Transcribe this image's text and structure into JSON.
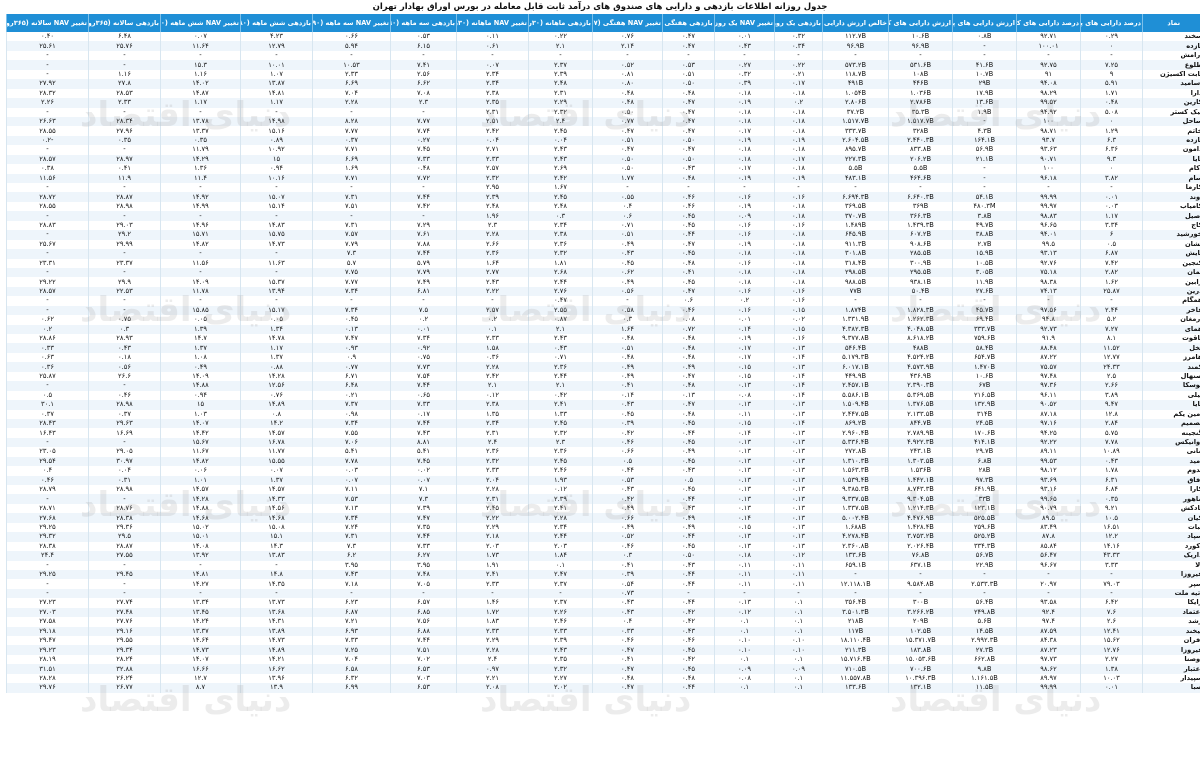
{
  "title": "جدول روزانه اطلاعات بازدهی و دارایی های صندوق های درآمد ثابت قابل معامله در بورس اوراق بهادار تهران",
  "watermark": "دنیای اقتصاد",
  "watermark_sub": "روزنامه صبح ایران",
  "columns": [
    "نماد",
    "درصد دارایی های پرریسک",
    "درصد دارایی های کم ریسک",
    "ارزش دارایی های پرریسک",
    "ارزش دارایی های کم ریسک",
    "خالص ارزش دارایی ها",
    "بازدهی یک روزه",
    "تغییر NAV یک روزه",
    "بازدهی هفتگی",
    "تغییر NAV هفتگی (۷روزه)",
    "بازدهی ماهانه (۳۰روزه)",
    "تغییر NAV ماهانه (۳۰روزه)",
    "بازدهی سه ماهه (۹۰روزه)",
    "تغییر NAV سه ماهه (۹۰روزه)",
    "بازدهی شش ماهه (۱۸۰روزه)",
    "تغییر NAV شش ماهه (۱۸۰روزه)",
    "بازدهی سالانه (۳۶۵روزه)",
    "تغییر NAV سالانه (۳۶۵روزه)"
  ],
  "rows": [
    [
      "سخند",
      "۰.۲۹",
      "۹۲.۷۱",
      "۰.۸B",
      "۱۰.۶B",
      "۱۱۲.۷B",
      "۰.۳۲",
      "۰.۰۱",
      "۰.۴۷",
      "۰.۷۶",
      "۰.۲۲",
      "۰.۱۱",
      "۰.۵۳",
      "۰.۶۶",
      "۴.۲۳",
      "۰.۰۷",
      "۶.۴۸",
      "۰.۴۰"
    ],
    [
      "بازده",
      "۰",
      "۱۰۰.۰۱",
      "-",
      "۹۶.۹B",
      "۹۶.۹B",
      "۰.۳۴",
      "۰.۴۳",
      "۰.۴۷",
      "۲.۱۴",
      "۲.۱",
      "۰.۶۱",
      "۶.۱۵",
      "۵.۹۴",
      "۱۲.۷۹",
      "۱۱.۶۴",
      "۲۵.۷۶",
      "۲۵.۶۱"
    ],
    [
      "آرامش",
      "-",
      "-",
      "-",
      "-",
      "-",
      "-",
      "-",
      "-",
      "-",
      "-",
      "-",
      "-",
      "-",
      "-",
      "-",
      "-",
      "-"
    ],
    [
      "طلوع",
      "۷.۲۵",
      "۹۲.۷۵",
      "۴۱.۶B",
      "۵۳۱.۶B",
      "۵۷۳.۲B",
      "۰.۲۲",
      "۰.۲۷",
      "۰.۵۳",
      "۰.۵۲",
      "۲.۳۷",
      "۰.۰۷",
      "۷.۴۱",
      "۱۰.۵۳",
      "۱۰.۰۱",
      "۱۵.۳",
      "-",
      "-"
    ],
    [
      "ثابت اکسیژن",
      "۹",
      "۹۱",
      "۱۰.۷B",
      "۱۰۸B",
      "۱۱۸.۷B",
      "۰.۲۱",
      "۰.۳۲",
      "۰.۵۱",
      "۰.۸۱",
      "۲.۳۹",
      "۲.۳۴",
      "۲.۵۶",
      "۲.۳۳",
      "۱.۰۷",
      "۱.۱۶",
      "۱.۱۶",
      "-"
    ],
    [
      "اسامید",
      "۵.۹۱",
      "۹۴.۰۸",
      "۲۹B",
      "۴۴۶B",
      "۴۹۱B",
      "۰.۱۷",
      "۰.۳۹",
      "۰.۵۰",
      "۰.۸۰",
      "۲.۴۸",
      "۲.۳۴",
      "۶.۶۲",
      "۶.۶۹",
      "۱۳.۸۷",
      "۱۴.۰۲",
      "۲۷.۸",
      "۲۷.۹۲"
    ],
    [
      "دارا",
      "۱.۷۱",
      "۹۸.۲۹",
      "۱۷.۹B",
      "۱.۰۳۶B",
      "۱.۰۵۴B",
      "۰.۱۸",
      "۰.۱۸",
      "۰.۴۸",
      "۰.۴۸",
      "۲.۳۱",
      "۲.۳۸",
      "۷.۰۸",
      "۷.۰۴",
      "۱۴.۸۱",
      "۱۴.۸۷",
      "۲۸.۵۳",
      "۲۸.۳۲"
    ],
    [
      "کارین",
      "۰.۴۸",
      "۹۹.۵۲",
      "۱۳.۶B",
      "۲.۷۸۶B",
      "۲.۸۰۶B",
      "۰.۲",
      "۰.۱۹",
      "۰.۴۷",
      "۰.۴۸",
      "۲.۲۹",
      "۲.۳۵",
      "۲.۳",
      "۲.۲۸",
      "۱.۱۷",
      "۱.۱۷",
      "۲.۳۳",
      "۲.۲۶"
    ],
    [
      "نیک کستر",
      "۵.۰۸",
      "۹۴.۹۲",
      "۱.۹B",
      "۳۵.۳B",
      "۳۷.۲B",
      "۰.۱۸",
      "۰.۱۸",
      "۰.۴۷",
      "۰.۵۰",
      "۲.۳۲",
      "۲.۳۱",
      "-",
      "-",
      "-",
      "-",
      "-",
      "-"
    ],
    [
      "ساحل",
      "۰",
      "۱۰۰",
      "-",
      "۱.۵۱۷.۷B",
      "۱.۵۱۷.۷B",
      "۰.۱۸",
      "۰.۱۸",
      "۰.۴۷",
      "۰.۷۷",
      "۲.۴",
      "۲.۵۱",
      "۷.۷۷",
      "۸.۲۸",
      "۱۴.۹۸",
      "۱۳.۷۸",
      "۲۸.۳۴",
      "۲۶.۶۳"
    ],
    [
      "خاتم",
      "۱.۲۹",
      "۹۸.۷۱",
      "۴.۳B",
      "۳۲۸B",
      "۳۳۳.۷B",
      "۰.۱۸",
      "۰.۱۷",
      "۰.۴۷",
      "۰.۴۷",
      "۲.۴۵",
      "۲.۴۲",
      "۷.۷۴",
      "۷.۷۷",
      "۱۵.۱۶",
      "۱۳.۳۷",
      "۲۷.۹۶",
      "۲۸.۵۵"
    ],
    [
      "بازده",
      "۶.۳",
      "۹۳.۷",
      "۱۶۴.۱B",
      "۲.۴۴۰.۳B",
      "۲.۶۰۴.۵B",
      "۰.۱۹",
      "۰.۱۹",
      "۰.۵۰",
      "۰.۵۱",
      "۰.۰۴",
      "۰.۰۴",
      "۰.۲۷",
      "۰.۳۷",
      "۰.۸۹",
      "۰.۳۵",
      "۰.۳۵",
      "-۰.۲"
    ],
    [
      "دامون",
      "۶.۳۶",
      "۹۳.۶۳",
      "۵۶.۹B",
      "۸۳۳.۸B",
      "۸۹۵.۷B",
      "۰.۱۸",
      "۰.۱۸",
      "۰.۴۷",
      "۰.۴۷",
      "۲.۴۳",
      "۲.۷۱",
      "۷.۴۵",
      "۷.۷۱",
      "۱۰.۹۲",
      "۱۱.۷۹",
      "-",
      "-"
    ],
    [
      "پایا",
      "۹.۳",
      "۹۰.۷۱",
      "۲۱.۱B",
      "۲۰۶.۲B",
      "۲۲۷.۳B",
      "۰.۱۷",
      "۰.۱۸",
      "۰.۵۰",
      "۰.۵۰",
      "۲.۴۳",
      "۲.۳۳",
      "۷.۳۳",
      "۶.۶۹",
      "۱۵",
      "۱۴.۲۹",
      "۲۸.۹۷",
      "۲۸.۵۷"
    ],
    [
      "آکام",
      "۰",
      "۱۰۰",
      "-",
      "۵.۵B",
      "۵.۵B",
      "۰.۱۸",
      "۰.۱۷",
      "۰.۴۳",
      "۰.۵۰",
      "۲.۶۹",
      "۲.۵۷",
      "۰.۴۸",
      "۱.۶۹",
      "۰.۹۴",
      "۱.۳۶",
      "۰.۴۱",
      "۰.۳۸"
    ],
    [
      "سام",
      "۳.۸۲",
      "۹۶.۱۸",
      "-",
      "۴۶۴.۶B",
      "۴۸۳.۱B",
      "۰.۱۹",
      "۰.۱۹",
      "۰.۴۸",
      "۱.۷۷",
      "۲.۴۲",
      "۲.۳۲",
      "۷.۷۲",
      "۷.۷۱",
      "۱۰.۱۶",
      "۱۱.۴",
      "۱۱.۹",
      "۱۱.۵۶"
    ],
    [
      "کارما",
      "-",
      "-",
      "-",
      "-",
      "-",
      "-",
      "-",
      "-",
      "-",
      "۱.۶۷",
      "۲.۹۵",
      "-",
      "-",
      "-",
      "-",
      "-",
      "-"
    ],
    [
      "آوند",
      "۰.۰۱",
      "۹۹.۹۹",
      "۵۴.۱B",
      "۶.۶۴۰.۳B",
      "۶.۶۹۴.۳B",
      "۰.۱۶",
      "۰.۱۶",
      "۰.۴۶",
      "۰.۵۵",
      "۲.۴۵",
      "۲.۳۹",
      "۷.۴۴",
      "۷.۳۱",
      "۱۵.۰۷",
      "۱۴.۹۲",
      "۲۸.۸۷",
      "۲۸.۷۲"
    ],
    [
      "کامیاب",
      "۰.۰۳",
      "۹۹.۹۷",
      "۴۸۰.۳M",
      "۳۶۹B",
      "۳۶۹.۵B",
      "۰.۱۸",
      "۰.۱۹",
      "۰.۴۶",
      "۰.۴",
      "۲.۴۸",
      "۲.۴۸",
      "۷.۴۲",
      "۷.۵۱",
      "۱۵.۱۴",
      "۱۴.۹۹",
      "۲۸.۹۸",
      "۲۸.۵۵"
    ],
    [
      "اصیل",
      "۱.۱۷",
      "۹۸.۸۳",
      "۳.۸B",
      "۳۶۶.۳B",
      "۳۷۰.۷B",
      "۰.۱۸",
      "۰.۰۹",
      "۰.۴۵",
      "۰.۶",
      "۰.۳",
      "۱.۹۶",
      "-",
      "-",
      "-",
      "-",
      "-",
      "-"
    ],
    [
      "کاج",
      "۳.۳۴",
      "۹۶.۶۵",
      "۴۹.۷B",
      "۱.۴۳۹.۳B",
      "۱.۴۸۹B",
      "۰.۱۶",
      "۰.۱۶",
      "۰.۴۵",
      "۰.۷۱",
      "۲.۳۴",
      "۲.۳",
      "۷.۲۹",
      "۷.۳۱",
      "۱۴.۸۳",
      "۱۴.۹۶",
      "۲۹.۰۳",
      "۲۸.۸۳"
    ],
    [
      "خورشید",
      "۶",
      "۹۴.۰۱",
      "۳۸.۸B",
      "۶۰۷.۲B",
      "۶۴۵.۹B",
      "۰.۱۸",
      "۰.۱۶",
      "۰.۴۴",
      "۰.۵۱",
      "۲.۳۸",
      "۲.۲۸",
      "۷.۶۱",
      "۷.۵۷",
      "۱۵.۷۵",
      "۱۵.۷۱",
      "۲۹.۲",
      "-"
    ],
    [
      "نشان",
      "۰.۵",
      "۹۹.۵",
      "۲.۷B",
      "۹۰۸.۶B",
      "۹۱۱.۳B",
      "۰.۱۸",
      "۰.۱۹",
      "۰.۴۷",
      "۰.۴۹",
      "۲.۳۶",
      "۲.۶۶",
      "۷.۸۸",
      "۷.۷۹",
      "۱۴.۷۳",
      "۱۴.۸۲",
      "۲۹.۹۹",
      "۲۵.۶۷"
    ],
    [
      "پایش",
      "۶.۸۷",
      "۹۳.۱۳",
      "۱۵.۹B",
      "۲۸۵.۵B",
      "۳۰۱.۸B",
      "۰.۱۸",
      "۰.۱۸",
      "۰.۴۵",
      "۰.۴۳",
      "۲.۳۲",
      "۲.۳۶",
      "۷.۴۴",
      "۷.۳",
      "-",
      "-",
      "-",
      "-"
    ],
    [
      "کنجین",
      "۷.۴۲",
      "۹۲.۷۶",
      "۱۰.۵B",
      "۳۰۰.۹B",
      "۳۱۸.۴B",
      "۰.۱۸",
      "۰.۱۶",
      "۰.۴۸",
      "۰.۴۵",
      "۱.۸۱",
      "۱.۶۴",
      "۵.۷۹",
      "۵.۷",
      "۱۱.۶۳",
      "۱۱.۵۶",
      "۲۳.۳۷",
      "۲۳.۳۱"
    ],
    [
      "بمان",
      "۲.۸۲",
      "۷۵.۱۸",
      "۳.۰۵B",
      "۲۹۵.۵B",
      "۲۹۸.۵B",
      "۰.۱۸",
      "۰.۱۸",
      "۰.۴۱",
      "۰.۶۲",
      "۲.۶۸",
      "۲.۷۷",
      "۷.۷۹",
      "۷.۷۵",
      "-",
      "-",
      "-",
      "-"
    ],
    [
      "رابین",
      "۱.۶۲",
      "۹۸.۳۸",
      "۱۱.۹B",
      "۹۳۸.۱B",
      "۹۸۸.۵B",
      "۰.۱۸",
      "۰.۱۸",
      "۰.۴۵",
      "۰.۴۹",
      "۲.۴۴",
      "۲.۴۳",
      "۷.۴۹",
      "۷.۷۷",
      "۱۵.۳۷",
      "۱۴.۰۹",
      "۲۹.۹",
      "۲۹.۲۲"
    ],
    [
      "درین",
      "۲۵.۸۷",
      "۷۴.۱۳",
      "۲۷.۶B",
      "۵۰.۴B",
      "۷۷B",
      "۰.۱۶",
      "۰.۱۶",
      "۰.۴۷",
      "۰.۵۶",
      "۲.۷۶",
      "۲.۲۲",
      "۶.۸۱",
      "۷.۳۴",
      "۱۳.۹۴",
      "۱۱.۷۸",
      "۲۲.۵۳",
      "۲۸.۵۷"
    ],
    [
      "همگام",
      "-",
      "-",
      "-",
      "-",
      "-",
      "۰.۱۶",
      "۰.۲",
      "۰.۶",
      "-",
      "۰.۴۷",
      "-",
      "-",
      "-",
      "-",
      "-",
      "-",
      "-"
    ],
    [
      "فاخر",
      "۲.۴۴",
      "۹۷.۵۶",
      "۴۵.۷B",
      "۱.۸۲۸.۳B",
      "۱.۸۷۴B",
      "۰.۱۵",
      "۰.۱۶",
      "۰.۴۶",
      "۰.۵۸",
      "۲.۵۵",
      "۲.۵۷",
      "۷.۵",
      "۷.۳۴",
      "۱۵.۱۷",
      "۱۵.۸۵",
      "-",
      "-"
    ],
    [
      "ارمغان",
      "۵.۲",
      "۹۴.۸",
      "۶۹.۴B",
      "۱.۲۶۲.۳B",
      "۱.۳۳۱.۹B",
      "۰.۰۲",
      "۰.۰۱",
      "۰.۰۸",
      "۰.۳",
      "۰.۸۷",
      "۰.۲",
      "۰.۲",
      "۰.۴۵",
      "۰.۰۵",
      "۰.۰۵",
      "۰.۷۵",
      "۰.۶۲"
    ],
    [
      "همای",
      "۷.۲۷",
      "۹۲.۷۳",
      "۳۳۳.۷B",
      "۴.۰۴۸.۵B",
      "۴.۳۸۲.۳B",
      "۰.۱۵",
      "۰.۱۴",
      "۰.۷۲",
      "۱.۶۴",
      "۲.۱",
      "۰.۱",
      "۰.۰۱",
      "۰.۱۳",
      "۱.۳۴",
      "۱.۳۹",
      "۰.۳",
      "۰.۲"
    ],
    [
      "یاقوت",
      "۸.۱",
      "۹۱.۹",
      "۷۵۹.۶B",
      "۸.۶۱۸.۲B",
      "۹.۳۷۷.۸B",
      "۰.۱۶",
      "۰.۱۹",
      "۰.۴۸",
      "۰.۴۸",
      "۲.۴۳",
      "۲.۳۳",
      "۷.۳۴",
      "۷.۴۷",
      "۱۴.۷۸",
      "۱۴.۷",
      "۲۸.۹۳",
      "۲۸.۸۶"
    ],
    [
      "نخل",
      "۱۱.۵۲",
      "۸۸.۴۸",
      "۵۸.۴B",
      "۴۸۸B",
      "۵۴۶.۴B",
      "۰.۱۳",
      "۰.۱۷",
      "۰.۴۸",
      "۰.۵۱",
      "۰.۴۳",
      "۱.۵۸",
      "۰.۹۲",
      "۰.۹۳",
      "۱.۱۷",
      "۱.۳۷",
      "۰.۴۳",
      "۰.۳۳"
    ],
    [
      "هامرز",
      "۱۲.۷۷",
      "۸۷.۲۲",
      "۶۵۴.۷B",
      "۴.۵۲۴.۲B",
      "۵.۱۷۹.۳B",
      "۰.۱۴",
      "۰.۱۷",
      "۰.۴۸",
      "۰.۴۸",
      "۰.۷۱",
      "۰.۳۶",
      "۰.۷۵",
      "۰.۹",
      "۱.۳۷",
      "۱.۰۸",
      "۰.۱۸",
      "۰.۶۳"
    ],
    [
      "کمند",
      "۲۴.۳۳",
      "۷۵.۵۷",
      "۱.۴۷۰B",
      "۴.۵۷۳.۹B",
      "۶.۰۱۷.۱B",
      "۰.۱۳",
      "۰.۱۵",
      "۰.۴۹",
      "۰.۴۹",
      "۲.۳۶",
      "۲.۲۸",
      "۷.۷۳",
      "۰.۷۷",
      "۰.۸۸",
      "۰.۴۹",
      "۰.۵۶",
      "۰.۳۶"
    ],
    [
      "صنهال",
      "۲.۵",
      "۹۷.۴۸",
      "۱۰.۶B",
      "۴۳۶.۹B",
      "۴۴۹.۹B",
      "۰.۱۴",
      "۰.۱۵",
      "۰.۴۷",
      "۰.۴۹",
      "۲.۴۴",
      "۲.۴۲",
      "۷.۵۴",
      "۶.۷۱",
      "۱۴.۲۸",
      "۱۴.۰۹",
      "۲۶.۶",
      "۲۵.۸۷"
    ],
    [
      "توسکا",
      "۲.۶۶",
      "۹۷.۳۶",
      "۶۷B",
      "۲.۳۹۰.۳B",
      "۲.۴۵۷.۱B",
      "۰.۱۴",
      "۰.۱۳",
      "۰.۴۸",
      "۰.۴۱",
      "۲.۱",
      "۲.۱",
      "۷.۴۴",
      "۶.۴۸",
      "۱۲.۵۶",
      "۱۴.۸۸",
      "-",
      "-"
    ],
    [
      "نیلی",
      "۳.۸۹",
      "۹۶.۱۱",
      "۲۱۶.۵B",
      "۵.۳۶۹.۵B",
      "۵.۵۸۶.۱B",
      "۰.۱۴",
      "۰.۰۸",
      "۰.۱۳",
      "۰.۱۴",
      "۰.۴۲",
      "۰.۱۲",
      "۰.۶۵",
      "۰.۲۱",
      "۰.۷۶",
      "۰.۹۴",
      "۰.۴۶",
      "۰.۵"
    ],
    [
      "پایا",
      "۹.۴۷",
      "۹۰.۵۲",
      "۱۳۲.۹B",
      "۱.۳۷۶.۵B",
      "۱.۵۰۹.۴B",
      "۰.۱۳",
      "۰.۱۳",
      "۰.۴۷",
      "۰.۴۳",
      "۲.۴۱",
      "۲.۳۸",
      "۷.۳۳",
      "۷.۳۷",
      "۱۴.۸۹",
      "۱۵",
      "۲۸.۹۸",
      "۳۰.۱"
    ],
    [
      "امین یکم",
      "۱۲.۸",
      "۸۷.۱۸",
      "۳۱۴B",
      "۲.۱۳۳.۵B",
      "۲.۴۴۷.۵B",
      "۰.۱۳",
      "۰.۱۱",
      "۰.۴۸",
      "۰.۴۵",
      "۱.۳۳",
      "۱.۳۵",
      "۰.۱۷",
      "۰.۹۸",
      "۰.۸",
      "۱.۰۳",
      "۰.۳۷",
      "۰.۳۷"
    ],
    [
      "تصمیم",
      "۲.۸۴",
      "۹۷.۱۶",
      "۲۴.۵B",
      "۸۴۴.۷B",
      "۸۶۹.۲B",
      "۰.۱۴",
      "۰.۱۵",
      "۰.۴۵",
      "۰.۳۹",
      "۲.۴۵",
      "۲.۳۴",
      "۷.۴۴",
      "۷.۳۴",
      "۱۴.۲",
      "۱۴.۰۷",
      "۲۹.۶۳",
      "۲۸.۴۳"
    ],
    [
      "گنجینه",
      "۵.۷۵",
      "۹۴.۲۵",
      "۱۷۰.۶B",
      "۲.۷۸۹.۹B",
      "۲.۹۶۰.۴B",
      "۰.۱۳",
      "۰.۱۴",
      "۰.۴۴",
      "۰.۴۲",
      "۲.۳۲",
      "۲.۳۱",
      "۷.۴۳",
      "۷.۵۵",
      "۱۴.۵۷",
      "۱۴.۴۲",
      "۱۶.۶۹",
      "۱۶.۴۳"
    ],
    [
      "اوانیکس",
      "۷.۷۸",
      "۹۲.۲۲",
      "۴۱۴.۱B",
      "۴.۹۲۲.۳B",
      "۵.۳۳۶.۴B",
      "۰.۱۳",
      "۰.۱۳",
      "۰.۴۵",
      "۰.۴۶",
      "۲.۳",
      "۲.۴",
      "۸.۸۱",
      "۷.۰۶",
      "۱۶.۷۸",
      "۱۵.۶۷",
      "-",
      "-"
    ],
    [
      "مانی",
      "۱۰.۸۹",
      "۸۹.۱۱",
      "۲۹.۷B",
      "۲۴۳.۱B",
      "۲۷۲.۸B",
      "۰.۱۳",
      "۰.۱۳",
      "۰.۴۹",
      "۰.۶۶",
      "۲.۳۶",
      "۲.۳۶",
      "۵.۴۱",
      "۵.۴۱",
      "۱۱.۷۷",
      "۱۱.۶۷",
      "۲۹.۰۵",
      "۲۳.۰۵"
    ],
    [
      "امید",
      "۰.۴۳",
      "۹۹.۵۳",
      "۶.۸B",
      "۱.۳۰۳.۵B",
      "۱.۳۱۰.۳B",
      "۰.۱۳",
      "۰.۱۳",
      "۰.۴۵",
      "۰.۵",
      "۲.۴۵",
      "۲.۳۲",
      "۷.۴۵",
      "۷.۷۸",
      "۱۵.۵۵",
      "۱۴.۸۲",
      "۳۰.۹۷",
      "۲۹.۵۴"
    ],
    [
      "ندوم",
      "۱.۷۸",
      "۹۸.۱۲",
      "۲۸B",
      "۱.۵۳۶B",
      "۱.۵۶۳.۳B",
      "۰.۱۳",
      "۰.۱۳",
      "۰.۴۳",
      "۰.۴۴",
      "۲.۴۶",
      "۲.۳۳",
      "۰.۰۲",
      "۰.۰۳",
      "۰.۰۷",
      "۰.۰۶",
      "۰.۰۴",
      "۰.۴"
    ],
    [
      "آفاق",
      "۶.۳۱",
      "۹۳.۶۹",
      "۹۷.۳B",
      "۱.۴۴۲.۱B",
      "۱.۵۳۹.۴B",
      "۰.۱۳",
      "۰.۱۳",
      "۰.۵",
      "۰.۵۳",
      "۱.۹۳",
      "۲.۰۴",
      "۰.۰۷",
      "۰.۰۷",
      "۱.۳۷",
      "۱.۰۱",
      "۰.۳۱",
      "۰.۴۶"
    ],
    [
      "کارا",
      "۶.۸۴",
      "۹۳.۱۶",
      "۶۴۱.۹B",
      "۸.۷۴۳.۳B",
      "۹.۳۸۵.۳B",
      "۰.۱۳",
      "۰.۱۳",
      "۰.۴۵",
      "۰.۴۳",
      "۰.۱۲",
      "۲.۲۸",
      "۷.۱",
      "۷.۱۱",
      "۱۴.۵۷",
      "۱۴.۵۷",
      "۲۸.۹۸",
      "۲۸.۷۹"
    ],
    [
      "ماهور",
      "۰.۳۵",
      "۹۹.۶۵",
      "۳۳B",
      "۹.۳۰۴.۵B",
      "۹.۳۳۷.۵B",
      "۰.۱۳",
      "۰.۱۳",
      "۰.۴۴",
      "۰.۴۲",
      "۲.۳۹",
      "۲.۳۱",
      "۷.۳",
      "۷.۵۳",
      "۱۴.۳۳",
      "۱۴.۲۸",
      "-",
      "-"
    ],
    [
      "یادکش",
      "۹.۲۱",
      "۹۰.۷۹",
      "۱۲۳.۱B",
      "۱.۲۱۴.۳B",
      "۱.۳۳۷.۵B",
      "۰.۱۳",
      "۰.۱۳",
      "۰.۴۳",
      "۰.۴۹",
      "۲.۴۱",
      "۲.۴۵",
      "۷.۳۹",
      "۷.۱۳",
      "۱۴.۵۶",
      "۱۴.۸۸",
      "۲۸.۷۶",
      "۲۸.۷۱"
    ],
    [
      "کیان",
      "۱۰.۵",
      "۸۹.۵",
      "۵۲۵.۵B",
      "۴.۴۷۶.۹B",
      "۵.۰۰۲.۴B",
      "۰.۱۳",
      "۰.۱۴",
      "۰.۴۹",
      "۰.۶۶",
      "۲.۲۸",
      "۲.۲۲",
      "۷.۴۷",
      "۷.۳۴",
      "۱۴.۶۸",
      "۱۴.۶۸",
      "۲۸.۳۸",
      "۲۷.۶۸"
    ],
    [
      "ثبات",
      "۱۶.۵۱",
      "۸۳.۴۹",
      "۲۵۹.۶B",
      "۱.۴۲۸.۴B",
      "۱.۶۸۸B",
      "۰.۱۳",
      "۰.۱۵",
      "۰.۴۹",
      "۰.۴۹",
      "۲.۳۴",
      "۲.۲۹",
      "۷.۳۵",
      "۷.۲۴",
      "۱۵.۰۸",
      "۱۵.۰۲",
      "۲۹.۳۶",
      "۲۹.۲۵"
    ],
    [
      "سپاد",
      "۱۲.۲",
      "۸۷.۸",
      "۵۲۵.۲B",
      "۳.۷۵۳.۲B",
      "۴.۲۷۸.۴B",
      "۰.۱۳",
      "۰.۱۳",
      "۰.۴۴",
      "۰.۵۲",
      "۲.۴۴",
      "۲.۱۸",
      "۷.۴۴",
      "۷.۳۱",
      "۱۵.۱",
      "۱۵.۰۱",
      "۲۹.۵",
      "۲۹.۳۲"
    ],
    [
      "آکورد",
      "۱۴.۱۶",
      "۸۵.۸۴",
      "۳۳۴.۳B",
      "۲.۰۲۶.۴B",
      "۲.۳۶۰.۸B",
      "۰.۱۳",
      "۰.۱۳",
      "۰.۴۵",
      "۰.۴۶",
      "۲.۰۳",
      "۲.۰۳",
      "۷.۳۳",
      "۷.۳",
      "۱۴.۳",
      "۱۴.۰۸",
      "۲۸.۸۷",
      "۲۸.۳۸"
    ],
    [
      "داریک",
      "۴۳.۳۳",
      "۵۶.۴۷",
      "۵۶.۷B",
      "۷۶.۸B",
      "۱۳۳.۶B",
      "۰.۱۲",
      "۰.۱۸",
      "۰.۵۰",
      "۰.۳",
      "۱.۸۴",
      "۱.۷۳",
      "۶.۲۷",
      "۶.۲",
      "۱۳.۸۳",
      "۱۳.۹۲",
      "۲۷.۵۵",
      "۲۴.۴"
    ],
    [
      "آلا",
      "۳.۳۳",
      "۹۶.۶۷",
      "۲۲.۹B",
      "۶۳۷.۱B",
      "۶۵۹.۱B",
      "۰.۱۱",
      "۰.۱۱",
      "۰.۴۳",
      "۰.۴۱",
      "۰.۱",
      "۱.۹۱",
      "۳.۹۵",
      "۳.۹۵",
      "-",
      "-",
      "-",
      "-"
    ],
    [
      "فیروزا",
      "-",
      "-",
      "-",
      "-",
      "-",
      "۰.۱۱",
      "۰.۱۱",
      "۰.۴۴",
      "۰.۳۹",
      "۲.۴۷",
      "۲.۴۱",
      "۷.۴۸",
      "۷.۴۳",
      "۱۴.۸",
      "۱۴.۸۱",
      "۲۹.۴۵",
      "۲۹.۲۵"
    ],
    [
      "سپر",
      "۷۹.۰۳",
      "۲۰.۹۷",
      "۲.۵۳۳.۳B",
      "۹.۵۸۴.۸B",
      "۱۲.۱۱۸.۱B",
      "۰.۱۱",
      "۰.۱۱",
      "۰.۴۴",
      "۰.۵۴",
      "۲.۳۷",
      "۲.۳۳",
      "۷.۰۵",
      "۷.۱۸",
      "۱۴.۳۵",
      "۱۴.۲۷",
      "-",
      "-"
    ],
    [
      "آتیه ملت",
      "-",
      "-",
      "-",
      "-",
      "-",
      "-",
      "-",
      "-",
      "۰.۷۳",
      "-",
      "-",
      "-",
      "-",
      "-",
      "-",
      "-",
      "-"
    ],
    [
      "رایکا",
      "۶.۴۲",
      "۹۳.۵۸",
      "۵۶.۴B",
      "۳۰۰B",
      "۳۵۶.۴B",
      "۰.۱",
      "۰.۱۳",
      "۰.۴۴",
      "۰.۴۳",
      "۲.۳۷",
      "۱.۴۶",
      "۶.۵۷",
      "۶.۲۳",
      "۱۳.۷۳",
      "۱۳.۳۴",
      "۲۷.۷۴",
      "۲۷.۲۳"
    ],
    [
      "اعتماد",
      "۷.۶",
      "۹۲.۴",
      "۲۴۹.۸B",
      "۳.۲۶۶.۲B",
      "۳.۵۰۱.۳B",
      "۰.۱",
      "۰.۱۲",
      "۰.۴۲",
      "۰.۴۳",
      "۲.۲۶",
      "۱.۷۲",
      "۶.۸۵",
      "۶.۸۷",
      "۱۳.۶۸",
      "۱۳.۴۵",
      "۲۷.۴۸",
      "۲۷.۰۳"
    ],
    [
      "رشد",
      "۲.۶",
      "۹۷.۴",
      "۵.۶B",
      "۲۰۹B",
      "۲۱۸B",
      "۰.۱",
      "۰.۱",
      "۰.۴۲",
      "۰.۴",
      "۲.۴۶",
      "۱.۸۳",
      "۷.۵۶",
      "۷.۲۱",
      "۱۴.۳۱",
      "۱۴.۲۴",
      "۲۷.۷۶",
      "۲۷.۵۸"
    ],
    [
      "لیخند",
      "۱۲.۴۱",
      "۸۷.۵۹",
      "۱۴.۵B",
      "۱۰۲.۵B",
      "۱۱۷B",
      "۰.۱",
      "۰.۱",
      "۰.۴۳",
      "۰.۳۳",
      "۲.۳۳",
      "۲.۳۳",
      "۶.۸۸",
      "۶.۹۳",
      "۱۳.۸۹",
      "۱۳.۳۷",
      "۲۹.۱۶",
      "۲۹.۱۸"
    ],
    [
      "افران",
      "۱۵.۶۲",
      "۸۴.۳۸",
      "۲.۹۹۲.۳B",
      "۱۵.۳۷۱.۷B",
      "۱۸.۱۱۰.۴B",
      "۰.۱۰",
      "۰.۱۰",
      "۰.۴۶",
      "۰.۴۶",
      "۲.۳۹",
      "۲.۲۹",
      "۷.۴۴",
      "۷.۳۳",
      "۱۴.۷۳",
      "۱۴.۶۴",
      "۲۹.۵۵",
      "۲۹.۴۷"
    ],
    [
      "فیروزا",
      "۱۲.۷۶",
      "۸۷.۲۳",
      "۲۷.۳B",
      "۱۸۳.۸B",
      "۲۱۱.۳B",
      "۰.۱۰",
      "۰.۱۰",
      "۰.۴۵",
      "۰.۴۷",
      "۲.۴۳",
      "۲.۲۸",
      "۷.۵۱",
      "۷.۲۵",
      "۱۴.۸۹",
      "۱۴.۷۳",
      "۲۹.۳۴",
      "۲۹.۲۳"
    ],
    [
      "اوصنا",
      "۲.۲۷",
      "۹۷.۷۳",
      "۶۶۲.۸B",
      "۱۵.۰۵۳.۶B",
      "۱۵.۷۱۶.۴B",
      "۰.۱",
      "۰.۱",
      "۰.۴۲",
      "۰.۴۱",
      "۲.۳۵",
      "۲.۴",
      "۷.۰۲",
      "۷.۰۴",
      "۱۴.۲۱",
      "۱۴.۰۷",
      "۲۸.۲۴",
      "۲۸.۱۹"
    ],
    [
      "اعتبار",
      "۱.۳۸",
      "۹۸.۶۲",
      "۹.۸B",
      "۷۰۰.۶B",
      "۷۱۰.۵B",
      "۰.۰۹",
      "۰.۰۹",
      "۰.۴۵",
      "۰.۴۷",
      "۲.۳۲",
      "۰.۹۷",
      "۶.۵۳",
      "۶.۵۸",
      "۱۶.۶۲",
      "۱۶.۶۶",
      "۳۲.۸۸",
      "۳۱.۵۱"
    ],
    [
      "سپیدار",
      "۱۰.۰۳",
      "۸۹.۹۷",
      "۱.۱۶۱.۵B",
      "۱۰.۳۹۶.۳B",
      "۱۱.۵۵۷.۸B",
      "۰.۱",
      "۰.۰۸",
      "۰.۴۸",
      "۰.۴۸",
      "۲.۲۷",
      "۲.۲۱",
      "۷.۰۳",
      "۶.۳۲",
      "۱۳.۹۶",
      "۱۲.۷",
      "۲۶.۲۴",
      "۲۸.۲۸"
    ],
    [
      "صبا",
      "۰.۰۱",
      "۹۹.۹۹",
      "۱۱.۵B",
      "۱۳۲.۱B",
      "۱۳۳.۶B",
      "۰.۱",
      "۰.۱",
      "۰.۴۴",
      "۰.۴۷",
      "۲.۰۲",
      "۲.۰۸",
      "۶.۵۳",
      "۶.۹۹",
      "۱۳.۹",
      "۸.۷",
      "۲۶.۷۷",
      "۲۹.۷۶"
    ]
  ]
}
